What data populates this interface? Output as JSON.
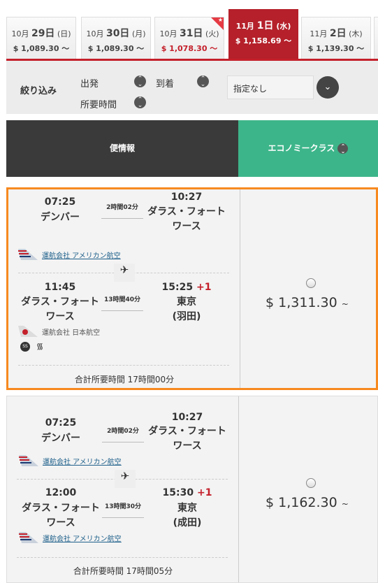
{
  "date_tabs": [
    {
      "month": "10月",
      "day": "29日",
      "weekday": "(日)",
      "price": "$ 1,089.30 〜"
    },
    {
      "month": "10月",
      "day": "30日",
      "weekday": "(月)",
      "price": "$ 1,089.30 〜"
    },
    {
      "month": "10月",
      "day": "31日",
      "weekday": "(火)",
      "price": "$ 1,078.30 〜",
      "lowest": true
    },
    {
      "month": "11月",
      "day": "1日",
      "weekday": "(水)",
      "price": "$ 1,158.69 〜",
      "selected": true
    },
    {
      "month": "11月",
      "day": "2日",
      "weekday": "(木)",
      "price": "$ 1,139.30 〜"
    }
  ],
  "filter": {
    "title": "絞り込み",
    "departure": "出発",
    "arrival": "到着",
    "duration": "所要時間",
    "select_value": "指定なし"
  },
  "header": {
    "flight_info": "便情報",
    "economy": "エコノミークラス"
  },
  "colors": {
    "accent_red": "#b5202a",
    "economy_green": "#3db58a",
    "selected_border": "#f7891f"
  },
  "results": [
    {
      "seg1": {
        "dep_time": "07:25",
        "dep_city": "デンバー",
        "duration": "2時間02分",
        "arr_time": "10:27",
        "arr_city": "ダラス・フォート\nワース",
        "operator": "運航会社 アメリカン航空",
        "operator_link": true
      },
      "seg2": {
        "dep_time": "11:45",
        "dep_city": "ダラス・フォート\nワース",
        "duration": "13時間40分",
        "arr_time": "15:25",
        "arr_plus": "+1",
        "arr_city": "東京\n(羽田)",
        "operator": "運航会社 日本航空",
        "operator_link": false
      },
      "amenities": [
        "seat-selection-icon",
        "wifi-icon"
      ],
      "total": "合計所要時間 17時間00分",
      "price": "$ 1,311.30",
      "price_suffix": "~"
    },
    {
      "seg1": {
        "dep_time": "07:25",
        "dep_city": "デンバー",
        "duration": "2時間02分",
        "arr_time": "10:27",
        "arr_city": "ダラス・フォート\nワース",
        "operator": "運航会社 アメリカン航空",
        "operator_link": true
      },
      "seg2": {
        "dep_time": "12:00",
        "dep_city": "ダラス・フォート\nワース",
        "duration": "13時間30分",
        "arr_time": "15:30",
        "arr_plus": "+1",
        "arr_city": "東京\n(成田)",
        "operator": "運航会社 アメリカン航空",
        "operator_link": true
      },
      "total": "合計所要時間 17時間05分",
      "price": "$ 1,162.30",
      "price_suffix": "~"
    }
  ]
}
